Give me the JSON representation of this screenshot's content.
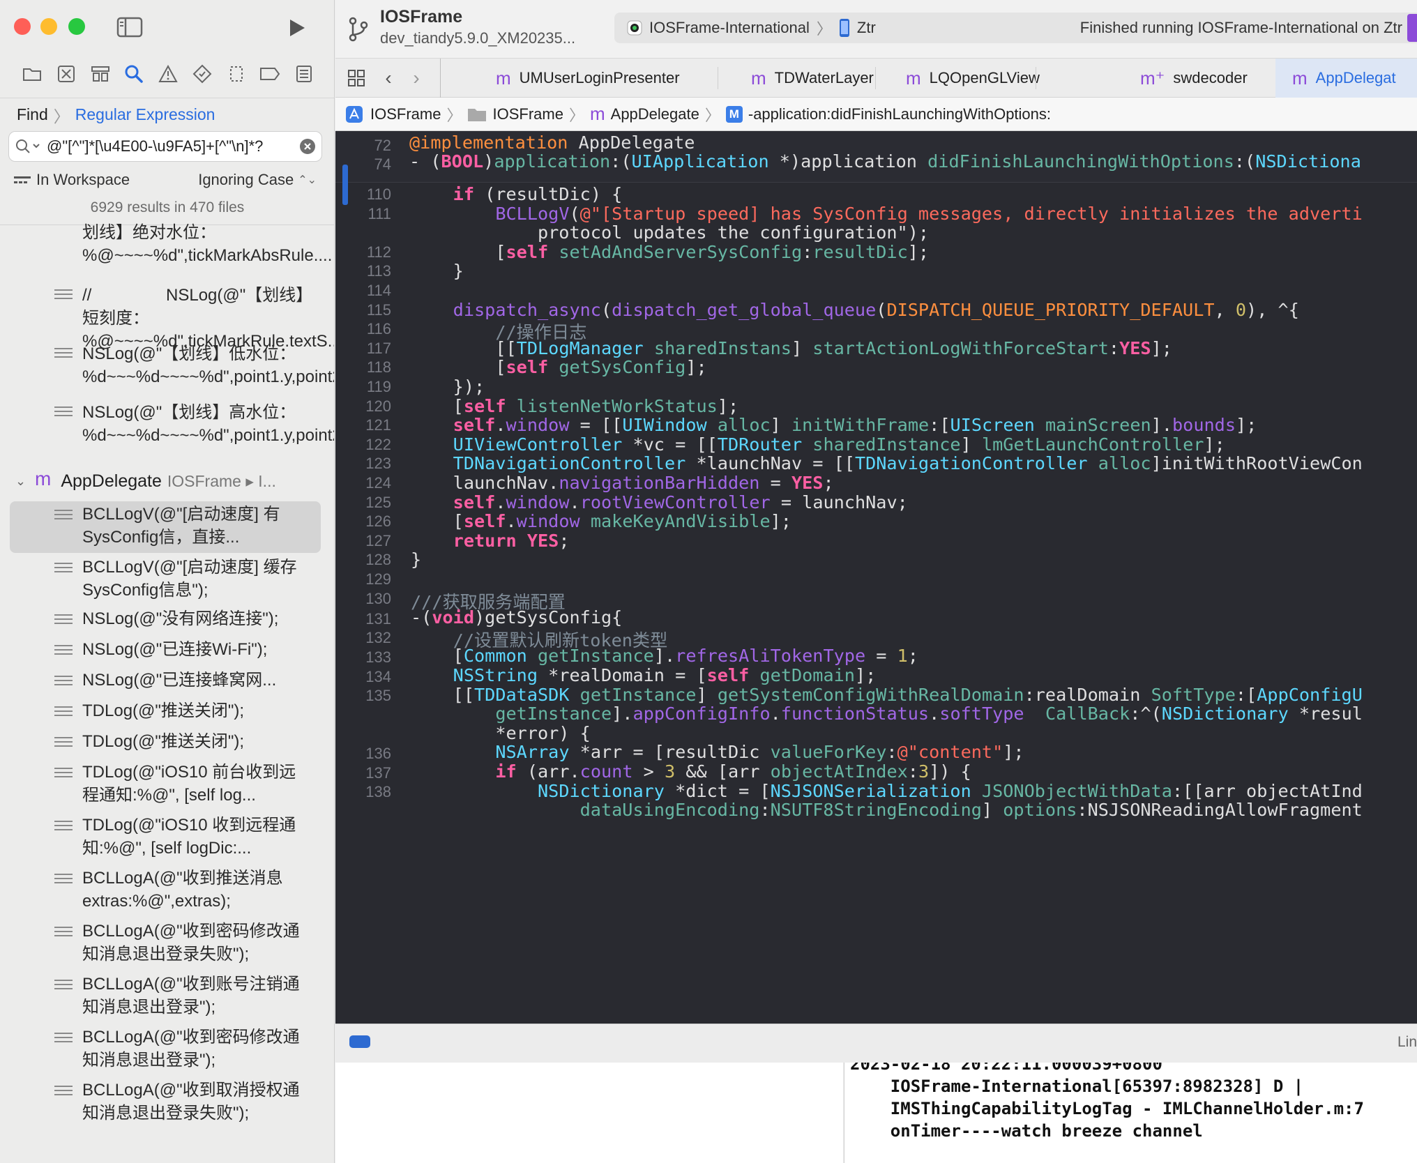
{
  "toolbar": {
    "project_name": "IOSFrame",
    "branch": "dev_tiandy5.9.0_XM20235...",
    "scheme": "IOSFrame-International",
    "device": "Ztr",
    "status": "Finished running IOSFrame-International on Ztr"
  },
  "tabs": [
    {
      "label": "UMUserLoginPresenter",
      "icon": "m"
    },
    {
      "label": "TDWaterLayer",
      "icon": "m"
    },
    {
      "label": "LQOpenGLView",
      "icon": "m"
    },
    {
      "label": "swdecoder",
      "icon": "m⁺"
    },
    {
      "label": "AppDelegat",
      "icon": "m"
    }
  ],
  "jumpbar": {
    "project": "IOSFrame",
    "folder": "IOSFrame",
    "file": "AppDelegate",
    "method": "-application:didFinishLaunchingWithOptions:"
  },
  "find": {
    "mode": "Find",
    "style": "Regular Expression",
    "query": "@\"[^\"]*[\\u4E00-\\u9FA5]+[^\"\\n]*?",
    "scope": "In Workspace",
    "case": "Ignoring Case",
    "summary": "6929 results in 470 files"
  },
  "results_top": [
    {
      "text": "划线】绝对水位：%@~~~~%d\",tickMarkAbsRule...."
    },
    {
      "text": "//                NSLog(@\"【划线】短刻度：%@~~~~%d\",tickMarkRule.textS..."
    },
    {
      "text": "NSLog(@\"【划线】低水位：%d~~~%d~~~~%d\",point1.y,point2.y,tRule.tGa..."
    },
    {
      "text": "NSLog(@\"【划线】高水位：%d~~~%d~~~~%d\",point1.y,point2.y,tRule.tGa..."
    }
  ],
  "group": {
    "name": "AppDelegate",
    "project": "IOSFrame ▸ I..."
  },
  "results": [
    "BCLLogV(@\"[启动速度] 有SysConfig信，直接...",
    "BCLLogV(@\"[启动速度] 缓存SysConfig信息\");",
    "NSLog(@\"没有网络连接\");",
    "NSLog(@\"已连接Wi-Fi\");",
    "NSLog(@\"已连接蜂窝网...",
    "TDLog(@\"推送关闭\");",
    "TDLog(@\"推送关闭\");",
    "TDLog(@\"iOS10 前台收到远程通知:%@\", [self log...",
    "TDLog(@\"iOS10 收到远程通知:%@\", [self logDic:...",
    "BCLLogA(@\"收到推送消息extras:%@\",extras);",
    "BCLLogA(@\"收到密码修改通知消息退出登录失败\");",
    "BCLLogA(@\"收到账号注销通知消息退出登录\");",
    "BCLLogA(@\"收到密码修改通知消息退出登录\");",
    "BCLLogA(@\"收到取消授权通知消息退出登录失败\");"
  ],
  "code": {
    "sticky": [
      {
        "ln": "72",
        "text": "@implementation AppDelegate"
      },
      {
        "ln": "74",
        "text": "- (BOOL)application:(UIApplication *)application didFinishLaunchingWithOptions:(NSDictiona"
      }
    ],
    "lines": [
      {
        "ln": "110",
        "text": "    if (resultDic) {"
      },
      {
        "ln": "111",
        "text": "        BCLLogV(@\"[Startup speed] has SysConfig messages, directly initializes the adverti"
      },
      {
        "ln": "",
        "text": "            protocol updates the configuration\");"
      },
      {
        "ln": "112",
        "text": "        [self setAdAndServerSysConfig:resultDic];"
      },
      {
        "ln": "113",
        "text": "    }"
      },
      {
        "ln": "114",
        "text": ""
      },
      {
        "ln": "115",
        "text": "    dispatch_async(dispatch_get_global_queue(DISPATCH_QUEUE_PRIORITY_DEFAULT, 0), ^{"
      },
      {
        "ln": "116",
        "text": "        //操作日志"
      },
      {
        "ln": "117",
        "text": "        [[TDLogManager sharedInstans] startActionLogWithForceStart:YES];"
      },
      {
        "ln": "118",
        "text": "        [self getSysConfig];"
      },
      {
        "ln": "119",
        "text": "    });"
      },
      {
        "ln": "120",
        "text": "    [self listenNetWorkStatus];"
      },
      {
        "ln": "121",
        "text": "    self.window = [[UIWindow alloc] initWithFrame:[UIScreen mainScreen].bounds];"
      },
      {
        "ln": "122",
        "text": "    UIViewController *vc = [[TDRouter sharedInstance] lmGetLaunchController];"
      },
      {
        "ln": "123",
        "text": "    TDNavigationController *launchNav = [[TDNavigationController alloc]initWithRootViewCon"
      },
      {
        "ln": "124",
        "text": "    launchNav.navigationBarHidden = YES;"
      },
      {
        "ln": "125",
        "text": "    self.window.rootViewController = launchNav;"
      },
      {
        "ln": "126",
        "text": "    [self.window makeKeyAndVisible];"
      },
      {
        "ln": "127",
        "text": "    return YES;"
      },
      {
        "ln": "128",
        "text": "}"
      },
      {
        "ln": "129",
        "text": ""
      },
      {
        "ln": "130",
        "text": "///获取服务端配置"
      },
      {
        "ln": "131",
        "text": "-(void)getSysConfig{"
      },
      {
        "ln": "132",
        "text": "    //设置默认刷新token类型"
      },
      {
        "ln": "133",
        "text": "    [Common getInstance].refresAliTokenType = 1;"
      },
      {
        "ln": "134",
        "text": "    NSString *realDomain = [self getDomain];"
      },
      {
        "ln": "135",
        "text": "    [[TDDataSDK getInstance] getSystemConfigWithRealDomain:realDomain SoftType:[AppConfigU"
      },
      {
        "ln": "",
        "text": "        getInstance].appConfigInfo.functionStatus.softType  CallBack:^(NSDictionary *resul"
      },
      {
        "ln": "",
        "text": "        *error) {"
      },
      {
        "ln": "136",
        "text": "        NSArray *arr = [resultDic valueForKey:@\"content\"];"
      },
      {
        "ln": "137",
        "text": "        if (arr.count > 3 && [arr objectAtIndex:3]) {"
      },
      {
        "ln": "138",
        "text": "            NSDictionary *dict = [NSJSONSerialization JSONObjectWithData:[[arr objectAtInd"
      },
      {
        "ln": "",
        "text": "                dataUsingEncoding:NSUTF8StringEncoding] options:NSJSONReadingAllowFragment"
      }
    ]
  },
  "debug": {
    "right_label": "Lin"
  },
  "console": {
    "lines": [
      "2023-02-18 20:22:11.000039+0800",
      "    IOSFrame-International[65397:8982328] D |",
      "    IMSThingCapabilityLogTag - IMLChannelHolder.m:7",
      "    onTimer----watch breeze channel"
    ]
  },
  "colors": {
    "accent": "#2a6de0",
    "editor_bg": "#292a30",
    "keyword": "#fc5fa3",
    "string": "#fc6a5d",
    "type": "#5dd8ff",
    "project_icon": "#8c4bd8"
  }
}
